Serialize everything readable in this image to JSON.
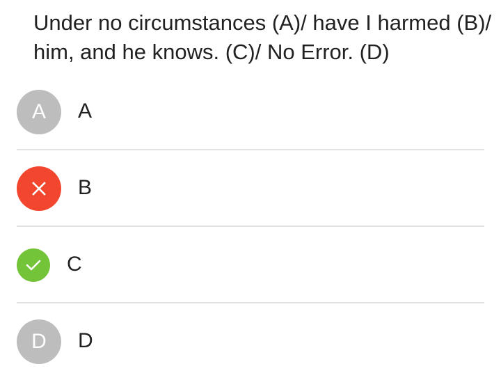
{
  "question": {
    "text": "Under no circumstances (A)/ have I harmed (B)/ him, and he knows. (C)/ No Error. (D)"
  },
  "options": [
    {
      "badge": "A",
      "label": "A",
      "state": "unselected",
      "icon": null
    },
    {
      "badge": "",
      "label": "B",
      "state": "wrong",
      "icon": "close-icon"
    },
    {
      "badge": "",
      "label": "C",
      "state": "correct",
      "icon": "check-icon"
    },
    {
      "badge": "D",
      "label": "D",
      "state": "unselected",
      "icon": null
    }
  ],
  "colors": {
    "unselected": "#bdbdbd",
    "wrong": "#f2472e",
    "correct": "#74c43a",
    "divider": "#e2e2e2",
    "text": "#212121"
  }
}
